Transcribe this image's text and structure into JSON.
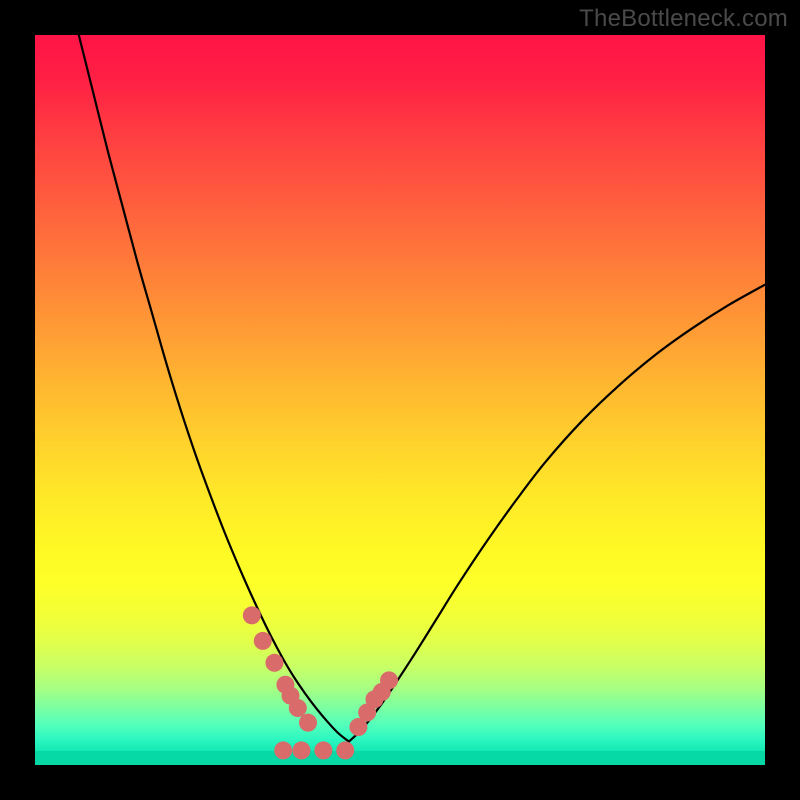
{
  "watermark": "TheBottleneck.com",
  "chart_data": {
    "type": "line",
    "title": "",
    "xlabel": "",
    "ylabel": "",
    "xlim": [
      0,
      100
    ],
    "ylim": [
      0,
      100
    ],
    "series": [
      {
        "name": "left-curve",
        "x": [
          6,
          8,
          10,
          12,
          14,
          16,
          18,
          20,
          22,
          24,
          26,
          28,
          30,
          32,
          34,
          35.5,
          37,
          38.5,
          40,
          41.5,
          43
        ],
        "y": [
          100,
          92,
          84,
          76.5,
          69,
          62,
          55,
          48.5,
          42.5,
          37,
          31.8,
          27,
          22.5,
          18.3,
          14.5,
          12,
          9.8,
          7.8,
          6.0,
          4.4,
          3.2
        ]
      },
      {
        "name": "right-curve",
        "x": [
          43,
          44.5,
          46,
          47.5,
          49,
          52,
          55,
          58,
          62,
          66,
          70,
          75,
          80,
          85,
          90,
          95,
          100
        ],
        "y": [
          3.2,
          4.6,
          6.4,
          8.4,
          10.6,
          15.2,
          20.0,
          24.8,
          30.8,
          36.4,
          41.6,
          47.2,
          52.0,
          56.2,
          59.8,
          63.0,
          65.8
        ]
      },
      {
        "name": "left-markers",
        "x": [
          29.7,
          31.2,
          32.8,
          34.3,
          35.0,
          36.0,
          37.4
        ],
        "y": [
          20.5,
          17.0,
          14.0,
          11.0,
          9.5,
          7.8,
          5.8
        ]
      },
      {
        "name": "right-markers",
        "x": [
          44.3,
          45.5,
          46.5,
          47.5,
          48.5
        ],
        "y": [
          5.2,
          7.2,
          9.0,
          10.0,
          11.6
        ]
      },
      {
        "name": "bottom-markers",
        "x": [
          34.0,
          36.5,
          39.5,
          42.5
        ],
        "y": [
          2.0,
          2.0,
          2.0,
          2.0
        ]
      }
    ],
    "curve_color": "#000000",
    "marker_color": "#d96b6b",
    "marker_radius": 9
  }
}
